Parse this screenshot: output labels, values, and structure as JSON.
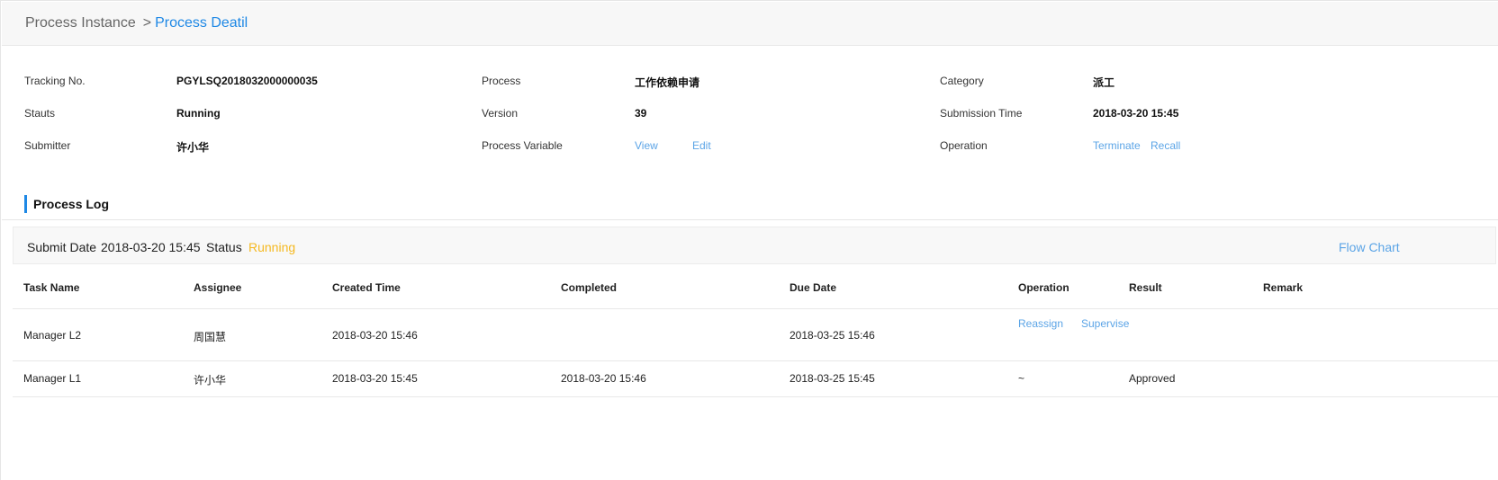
{
  "breadcrumb": {
    "root": "Process Instance",
    "separator": ">",
    "current": "Process Deatil"
  },
  "info": {
    "tracking_label": "Tracking No.",
    "tracking_value": "PGYLSQ2018032000000035",
    "process_label": "Process",
    "process_value": "工作依赖申请",
    "category_label": "Category",
    "category_value": "派工",
    "status_label": "Stauts",
    "status_value": "Running",
    "version_label": "Version",
    "version_value": "39",
    "submission_label": "Submission Time",
    "submission_value": "2018-03-20 15:45",
    "submitter_label": "Submitter",
    "submitter_value": "许小华",
    "variable_label": "Process Variable",
    "variable_view": "View",
    "variable_edit": "Edit",
    "operation_label": "Operation",
    "operation_terminate": "Terminate",
    "operation_recall": "Recall"
  },
  "log": {
    "title": "Process Log",
    "submit_date_label": "Submit Date",
    "submit_date_value": "2018-03-20 15:45",
    "status_label": "Status",
    "status_value": "Running",
    "flow_chart": "Flow Chart",
    "status_color": "#f5b921"
  },
  "table": {
    "columns": [
      "Task Name",
      "Assignee",
      "Created Time",
      "Completed",
      "Due Date",
      "Operation",
      "Result",
      "Remark"
    ],
    "rows": [
      {
        "task": "Manager L2",
        "assignee": "周国慧",
        "created": "2018-03-20 15:46",
        "completed": "",
        "due": "2018-03-25 15:46",
        "op_reassign": "Reassign",
        "op_supervise": "Supervise",
        "result": "",
        "remark": ""
      },
      {
        "task": "Manager L1",
        "assignee": "许小华",
        "created": "2018-03-20 15:45",
        "completed": "2018-03-20 15:46",
        "due": "2018-03-25 15:45",
        "operation": "~",
        "result": "Approved",
        "remark": ""
      }
    ]
  },
  "colors": {
    "accent": "#1e88e5",
    "link": "#5ba4e6",
    "running": "#f5b921"
  }
}
